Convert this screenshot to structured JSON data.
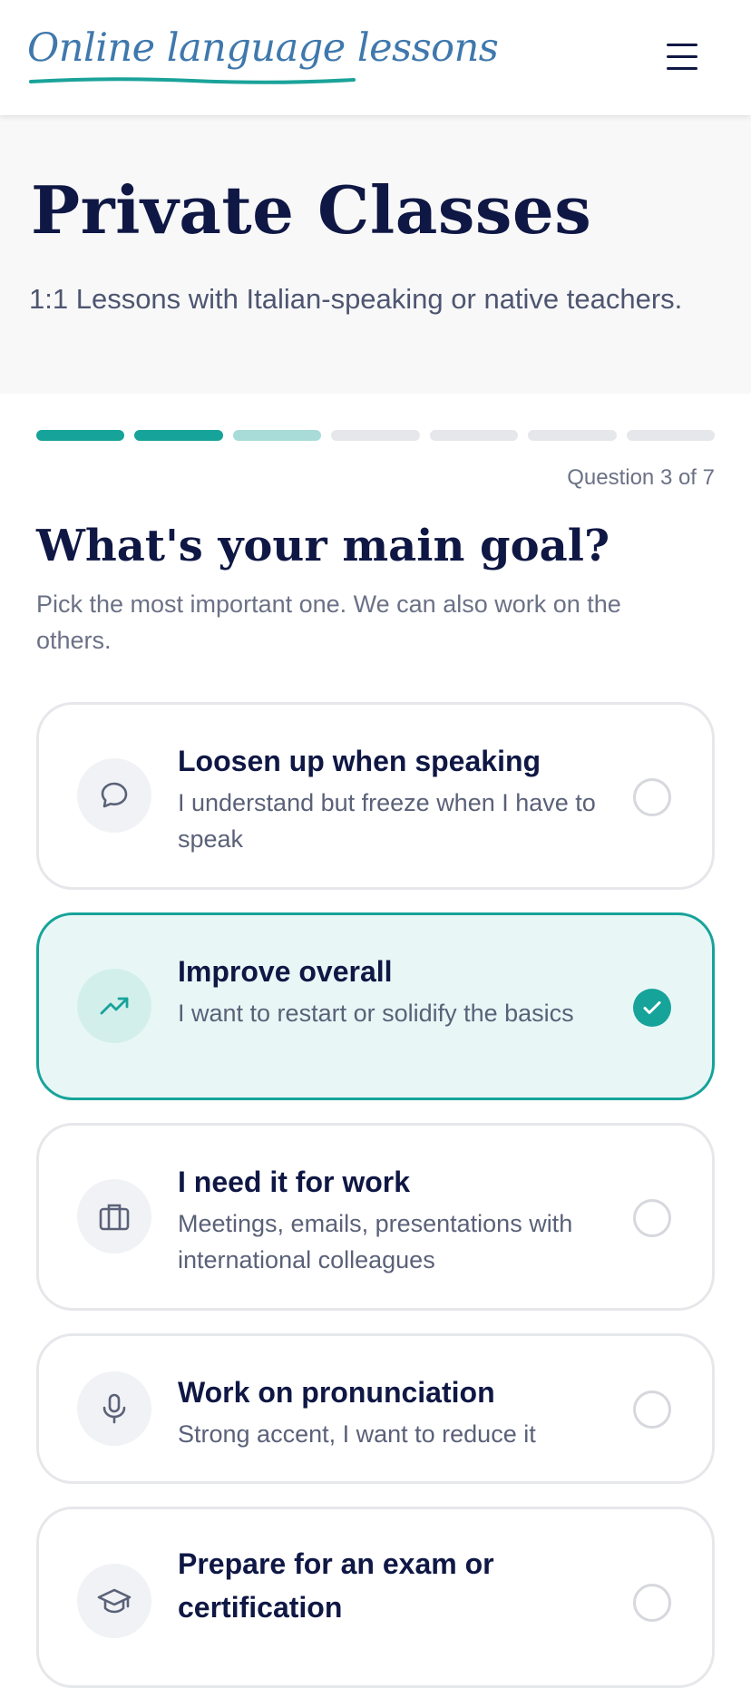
{
  "header": {
    "logo_text": "Online language lessons",
    "logo_icon": "brush-underline",
    "menu_icon": "hamburger-icon"
  },
  "hero": {
    "title": "Private Classes",
    "subtitle": "1:1 Lessons with Italian-speaking or native teachers."
  },
  "progress": {
    "total_steps": 7,
    "completed_steps": 2,
    "current_step": 3,
    "label": "Question 3 of 7"
  },
  "question": {
    "title": "What's your main goal?",
    "subtitle": "Pick the most important one. We can also work on the others."
  },
  "options": [
    {
      "title": "Loosen up when speaking",
      "description": "I understand but freeze when I have to speak",
      "icon": "speech-bubble-icon",
      "selected": false
    },
    {
      "title": "Improve overall",
      "description": "I want to restart or solidify the basics",
      "icon": "trending-up-icon",
      "selected": true
    },
    {
      "title": "I need it for work",
      "description": "Meetings, emails, presentations with international colleagues",
      "icon": "briefcase-icon",
      "selected": false
    },
    {
      "title": "Work on pronunciation",
      "description": "Strong accent, I want to reduce it",
      "icon": "microphone-icon",
      "selected": false
    },
    {
      "title": "Prepare for an exam or certification",
      "description": "",
      "icon": "graduation-cap-icon",
      "selected": false
    }
  ],
  "colors": {
    "accent": "#16a39a",
    "accent_light": "#a8dcd8",
    "navy": "#0f1744",
    "selected_bg": "#e8f7f6",
    "logo_blue": "#3f78ad"
  }
}
